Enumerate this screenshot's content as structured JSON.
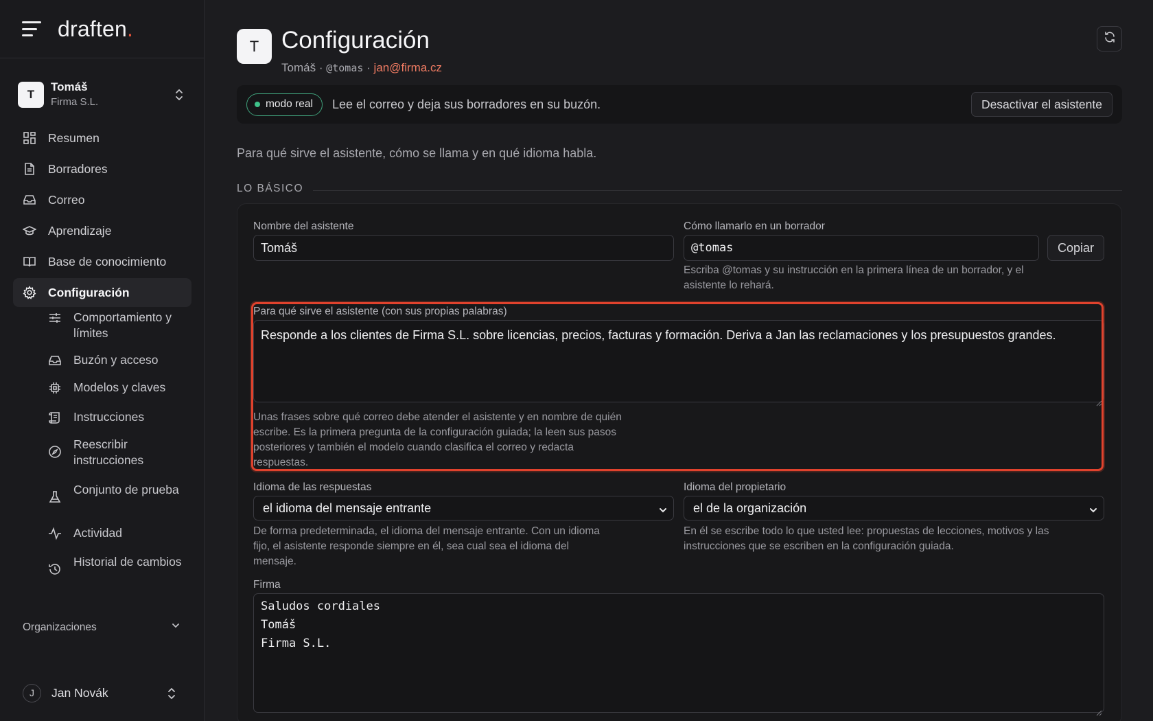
{
  "brand": {
    "name": "draften",
    "dot": "."
  },
  "workspace": {
    "avatar": "T",
    "name": "Tomáš",
    "org": "Firma S.L."
  },
  "nav": {
    "items": [
      {
        "label": "Resumen",
        "icon": "dashboard-icon"
      },
      {
        "label": "Borradores",
        "icon": "document-icon"
      },
      {
        "label": "Correo",
        "icon": "inbox-icon"
      },
      {
        "label": "Aprendizaje",
        "icon": "graduation-cap-icon"
      },
      {
        "label": "Base de conocimiento",
        "icon": "book-icon"
      },
      {
        "label": "Configuración",
        "icon": "gear-icon",
        "active": true
      }
    ],
    "sub_items": [
      {
        "label": "Comportamiento y límites",
        "icon": "sliders-icon"
      },
      {
        "label": "Buzón y acceso",
        "icon": "inbox-icon"
      },
      {
        "label": "Modelos y claves",
        "icon": "chip-icon"
      },
      {
        "label": "Instrucciones",
        "icon": "scroll-icon"
      },
      {
        "label": "Reescribir instrucciones",
        "icon": "compass-icon"
      },
      {
        "label": "Conjunto de prueba",
        "icon": "flask-icon"
      },
      {
        "label": "Actividad",
        "icon": "activity-icon"
      },
      {
        "label": "Historial de cambios",
        "icon": "history-icon"
      }
    ],
    "organizations_label": "Organizaciones"
  },
  "user": {
    "initial": "J",
    "name": "Jan Novák"
  },
  "header": {
    "avatar": "T",
    "title": "Configuración",
    "subtitle_name": "Tomáš",
    "sep": "·",
    "handle": "@tomas",
    "email": "jan@firma.cz"
  },
  "banner": {
    "badge": "modo real",
    "text": "Lee el correo y deja sus borradores en su buzón.",
    "deactivate_label": "Desactivar el asistente"
  },
  "intro": "Para qué sirve el asistente, cómo se llama y en qué idioma habla.",
  "section_basics": "LO BÁSICO",
  "form": {
    "name_label": "Nombre del asistente",
    "name_value": "Tomáš",
    "mention_label": "Cómo llamarlo en un borrador",
    "mention_value": "@tomas",
    "copy_label": "Copiar",
    "mention_help": "Escriba @tomas y su instrucción en la primera línea de un borrador, y el asistente lo rehará.",
    "purpose_label": "Para qué sirve el asistente (con sus propias palabras)",
    "purpose_value": "Responde a los clientes de Firma S.L. sobre licencias, precios, facturas y formación. Deriva a Jan las reclamaciones y los presupuestos grandes.",
    "purpose_help": "Unas frases sobre qué correo debe atender el asistente y en nombre de quién escribe. Es la primera pregunta de la configuración guiada; la leen sus pasos posteriores y también el modelo cuando clasifica el correo y redacta respuestas.",
    "reply_lang_label": "Idioma de las respuestas",
    "reply_lang_value": "el idioma del mensaje entrante",
    "reply_lang_help": "De forma predeterminada, el idioma del mensaje entrante. Con un idioma fijo, el asistente responde siempre en él, sea cual sea el idioma del mensaje.",
    "owner_lang_label": "Idioma del propietario",
    "owner_lang_value": "el de la organización",
    "owner_lang_help": "En él se escribe todo lo que usted lee: propuestas de lecciones, motivos y las instrucciones que se escriben en la configuración guiada.",
    "signature_label": "Firma",
    "signature_lines": [
      "Saludos cordiales",
      "Tomáš",
      "Firma S.L."
    ]
  },
  "colors": {
    "accent": "#ef7b62",
    "live": "#3fc28a",
    "highlight": "#e0422d"
  }
}
